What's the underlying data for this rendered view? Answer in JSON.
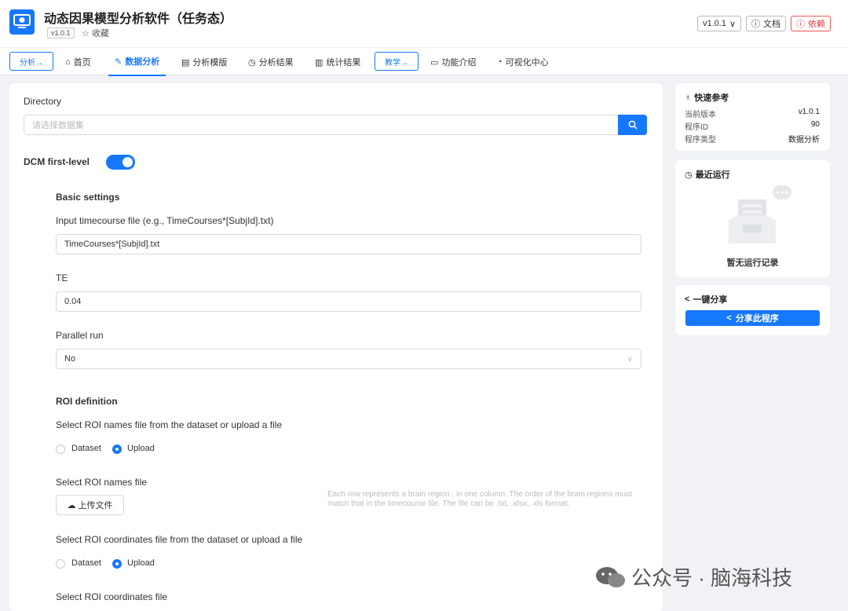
{
  "app": {
    "title": "动态因果模型分析软件（任务态）",
    "version_badge": "v1.0.1",
    "favorite_label": "收藏"
  },
  "header_actions": {
    "version_select": "v1.0.1",
    "docs_label": "文档",
    "deps_label": "依赖"
  },
  "nav": {
    "analyze_pill": "分析→",
    "teach_pill": "教学→",
    "items": [
      {
        "label": "首页",
        "icon": "home-icon"
      },
      {
        "label": "数据分析",
        "icon": "edit-icon",
        "active": true
      },
      {
        "label": "分析模版",
        "icon": "file-icon"
      },
      {
        "label": "分析结果",
        "icon": "history-icon"
      },
      {
        "label": "统计结果",
        "icon": "bar-chart-icon"
      },
      {
        "label": "功能介绍",
        "icon": "presentation-icon"
      },
      {
        "label": "可视化中心",
        "icon": "pie-chart-icon"
      }
    ]
  },
  "form": {
    "directory_label": "Directory",
    "directory_placeholder": "请选择数据集",
    "dcm_label": "DCM first-level",
    "dcm_enabled": true,
    "basic_settings_title": "Basic settings",
    "timecourse_label": "Input timecourse file (e.g., TimeCourses*[SubjId].txt)",
    "timecourse_value": "TimeCourses*[SubjId].txt",
    "te_label": "TE",
    "te_value": "0.04",
    "parallel_label": "Parallel run",
    "parallel_value": "No",
    "roi_title": "ROI definition",
    "roi_names_source_label": "Select ROI names file from the dataset or upload a file",
    "option_dataset": "Dataset",
    "option_upload": "Upload",
    "roi_names_source_selected": "Upload",
    "roi_names_file_label": "Select ROI names file",
    "upload_button": "上传文件",
    "roi_names_hint": "Each row represents a brain region , in one column. The order of the brain regions must match that in the timecourse file. The file can be .txt, .xlsx, .xls format.",
    "roi_coords_source_label": "Select ROI coordinates file from the dataset or upload a file",
    "roi_coords_source_selected": "Upload",
    "roi_coords_file_label": "Select ROI coordinates file"
  },
  "sidebar": {
    "quick_ref": {
      "title": "快速参考",
      "rows": [
        {
          "key": "当前版本",
          "value": "v1.0.1"
        },
        {
          "key": "程序ID",
          "value": "90"
        },
        {
          "key": "程序类型",
          "value": "数据分析"
        }
      ]
    },
    "recent": {
      "title": "最近运行",
      "empty_text": "暂无运行记录"
    },
    "share": {
      "title": "一键分享",
      "button": "分享此程序"
    }
  },
  "watermark": {
    "text": "公众号 · 脑海科技"
  },
  "colors": {
    "primary": "#1677ff",
    "danger": "#e33"
  }
}
